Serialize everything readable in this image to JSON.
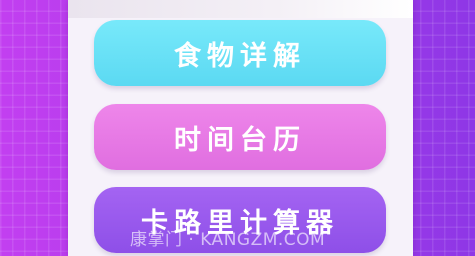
{
  "menu": {
    "items": [
      {
        "label": "食物详解",
        "color": "#6ae2f6"
      },
      {
        "label": "时间台历",
        "color": "#e87ae6"
      },
      {
        "label": "卡路里计算器",
        "color": "#9a5af0"
      }
    ]
  },
  "watermark": {
    "text": "康掌门 · KANGZM.COM"
  },
  "colors": {
    "background": "#b03ce8",
    "panel": "#f6f2fa"
  }
}
